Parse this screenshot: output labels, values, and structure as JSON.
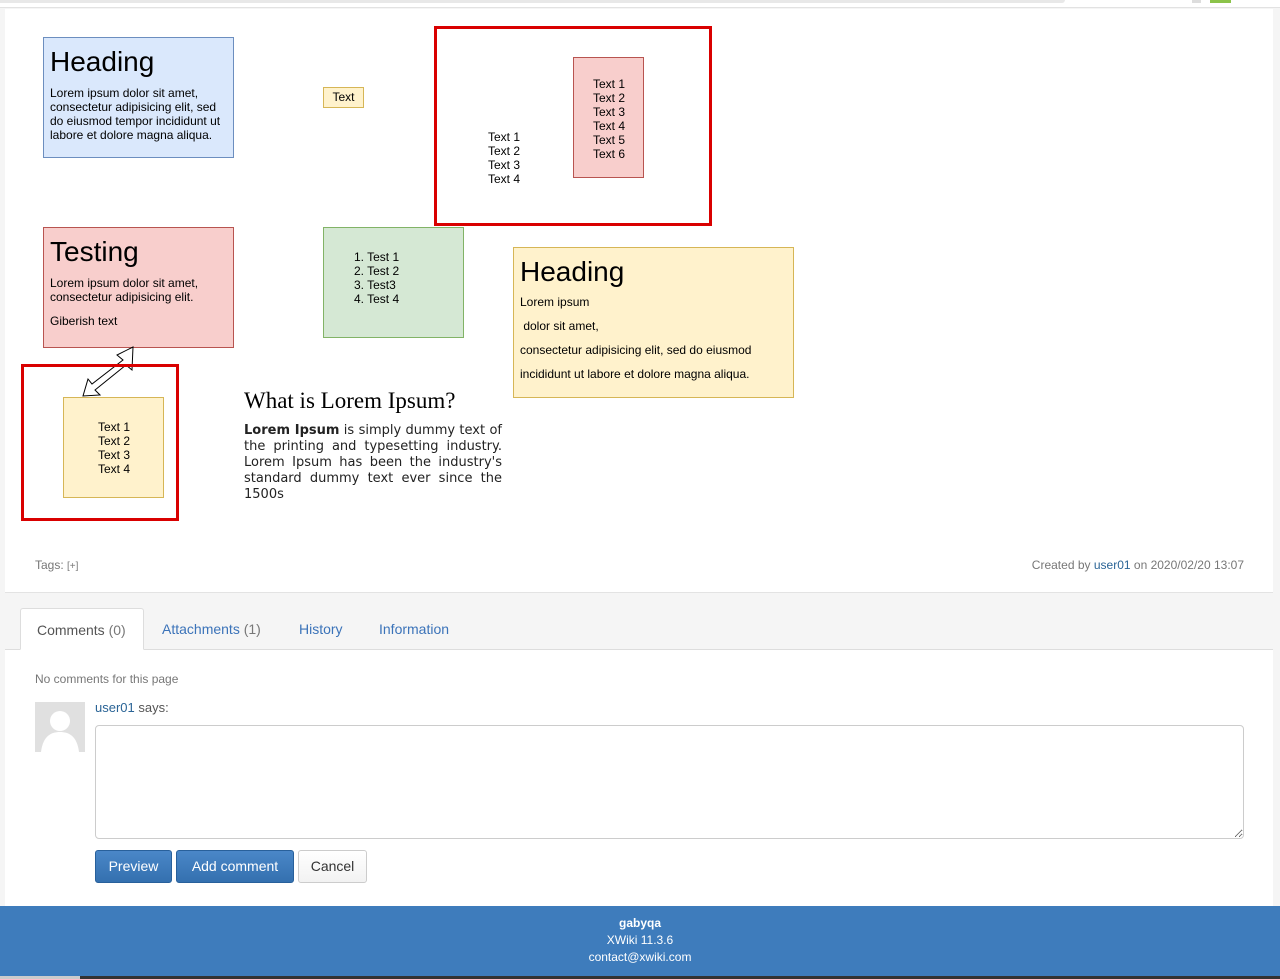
{
  "diagram": {
    "box_heading": {
      "title": "Heading",
      "text": "Lorem ipsum dolor sit amet, consectetur adipisicing elit, sed do eiusmod tempor incididunt ut labore et dolore magna aliqua."
    },
    "text_label": "Text",
    "frame_top": {
      "list_left": [
        "Text 1",
        "Text 2",
        "Text 3",
        "Text 4"
      ],
      "list_right": [
        "Text 1",
        "Text 2",
        "Text 3",
        "Text 4",
        "Text 5",
        "Text 6"
      ]
    },
    "box_testing": {
      "title": "Testing",
      "text": "Lorem ipsum dolor sit amet, consectetur adipisicing elit.",
      "extra": "Giberish text"
    },
    "numbered_list": [
      "Test 1",
      "Test 2",
      "Test3",
      "Test 4"
    ],
    "box_heading2": {
      "title": "Heading",
      "lines": [
        "Lorem ipsum",
        " dolor sit amet,",
        "consectetur adipisicing elit, sed do eiusmod",
        "incididunt ut labore et dolore magna aliqua."
      ]
    },
    "frame_bottom": {
      "list": [
        "Text 1",
        "Text 2",
        "Text 3",
        "Text 4"
      ]
    },
    "lorem_title": "What is Lorem Ipsum?",
    "lorem_bold": "Lorem Ipsum",
    "lorem_rest": " is simply dummy text of the printing and typesetting industry. Lorem Ipsum has been the industry's standard dummy text ever since the 1500s"
  },
  "page_meta": {
    "tags_label": "Tags:",
    "tags_add": "[+]",
    "created_prefix": "Created by",
    "created_user": "user01",
    "created_on": "on 2020/02/20 13:07"
  },
  "tabs": {
    "comments": "Comments",
    "comments_count": "(0)",
    "attachments": "Attachments",
    "attachments_count": "(1)",
    "history": "History",
    "information": "Information"
  },
  "comments": {
    "empty_text": "No comments for this page",
    "author": "user01",
    "says": "says:",
    "textarea_value": "",
    "preview_button": "Preview",
    "add_button": "Add comment",
    "cancel_button": "Cancel"
  },
  "footer": {
    "site": "gabyqa",
    "version": "XWiki 11.3.6",
    "contact": "contact@xwiki.com"
  },
  "colors": {
    "accent": "#3e7cbc",
    "frame_red": "#d90000",
    "link": "#2a6496"
  }
}
